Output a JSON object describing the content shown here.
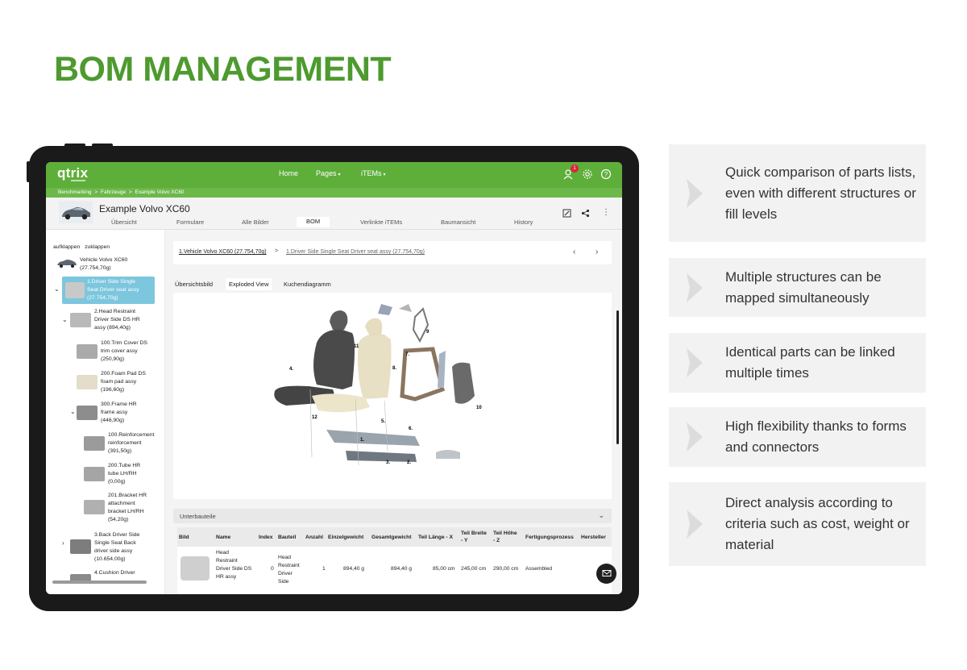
{
  "headline": "BOM MANAGEMENT",
  "app": {
    "logo": "qtrix",
    "nav": {
      "home": "Home",
      "pages": "Pages",
      "items": "iTEMs"
    },
    "notification_count": "1",
    "breadcrumb": [
      "Benchmarking",
      ">",
      "Fahrzeuge",
      ">",
      "Example Volvo XC60"
    ],
    "title": "Example Volvo XC60",
    "tabs": [
      "Übersicht",
      "Formulare",
      "Alle Bilder",
      "BOM",
      "Verlinkte iTEMs",
      "Baumansicht",
      "History"
    ],
    "active_tab": "BOM",
    "tree": {
      "expand_all": "aufklappen",
      "collapse_all": "zuklappen",
      "nodes": [
        {
          "label": "Vehicle Volvo XC60\n(27.754,70g)"
        },
        {
          "label": "1.Driver Side Single\nSeat Driver seat assy\n(27.754,70g)",
          "selected": true
        },
        {
          "label": "2.Head Restraint\nDriver Side DS HR\nassy (894,40g)"
        },
        {
          "label": "100.Trim Cover DS\ntrim cover assy\n(250,90g)"
        },
        {
          "label": "200.Foam Pad DS\nfoam pad assy\n(196,60g)"
        },
        {
          "label": "300.Frame HR\nframe assy\n(446,90g)"
        },
        {
          "label": "100.Reinforcement\nreinforcement\n(391,50g)"
        },
        {
          "label": "200.Tube HR\ntube LH/RH\n(0,00g)"
        },
        {
          "label": "201.Bracket HR\nattachment\nbracket LH/RH\n(54,20g)"
        },
        {
          "label": "3.Back Driver Side\nSingle Seat Back\ndriver side assy\n(10.654,00g)"
        },
        {
          "label": "4.Cushion Driver"
        }
      ]
    },
    "path": {
      "first": "1.Vehicle Volvo XC60 (27.754,70g)",
      "separator": ">",
      "second": "1.Driver Side Single Seat Driver seat assy (27.754,70g)"
    },
    "view_tabs": [
      "Übersichtsbild",
      "Exploded View",
      "Kuchendiagramm"
    ],
    "active_view_tab": "Exploded View",
    "exploded_labels": [
      "11",
      "4.",
      "8.",
      "7.",
      "9",
      "10",
      "12",
      "1.",
      "5.",
      "6.",
      "3.",
      "2."
    ],
    "subparts_title": "Unterbauteile",
    "table": {
      "headers": [
        "Bild",
        "Name",
        "Index",
        "Bauteil",
        "Anzahl",
        "Einzelgewicht",
        "Gesamtgewicht",
        "Teil Länge - X",
        "Teil Breite\n- Y",
        "Teil Höhe\n- Z",
        "Fertigungsprozess",
        "Hersteller"
      ],
      "row": {
        "name": "Head\nRestraint\nDriver Side DS\nHR assy",
        "index": "0",
        "bauteil": "Head\nRestraint\nDriver\nSide",
        "anzahl": "1",
        "einzelgewicht": "894,40 g",
        "gesamtgewicht": "894,40 g",
        "laenge": "85,00 cm",
        "breite": "245,00 cm",
        "hoehe": "290,00 cm",
        "prozess": "Assembled"
      }
    }
  },
  "features": [
    "Quick comparison of parts lists, even with different structures or fill levels",
    "Multiple structures can be mapped simultaneously",
    "Identical parts can be linked multiple times",
    "High flexibility thanks to forms and connectors",
    "Direct analysis according to criteria such as cost, weight or material"
  ],
  "colors": {
    "brand_green": "#4e9a2f",
    "topbar_green": "#5eae3a",
    "selected_node": "#7cc6de",
    "card_bg": "#f2f2f2"
  }
}
